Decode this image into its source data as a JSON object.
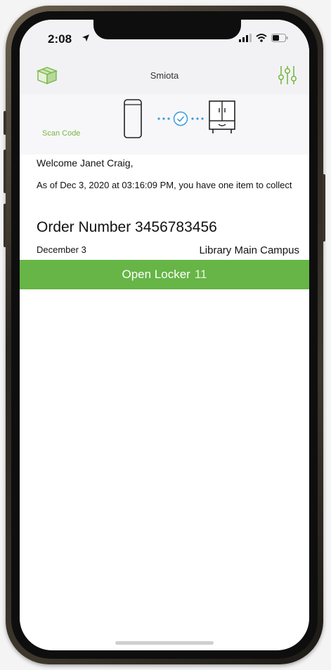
{
  "status_bar": {
    "time": "2:08"
  },
  "nav": {
    "title": "Smiota",
    "left_icon": "box-icon",
    "right_icon": "sliders-icon"
  },
  "stepper": {
    "scan_label": "Scan Code"
  },
  "message": {
    "welcome": "Welcome Janet Craig,",
    "as_of": "As of Dec 3, 2020 at 03:16:09 PM, you have one item to collect"
  },
  "order": {
    "number": "Order Number 3456783456",
    "date": "December 3",
    "location": "Library Main Campus"
  },
  "locker_button": {
    "label": "Open Locker",
    "number": "11"
  },
  "colors": {
    "accent_green": "#66b546",
    "scan_label_green": "#7ab648",
    "step_blue": "#3a9be0"
  }
}
